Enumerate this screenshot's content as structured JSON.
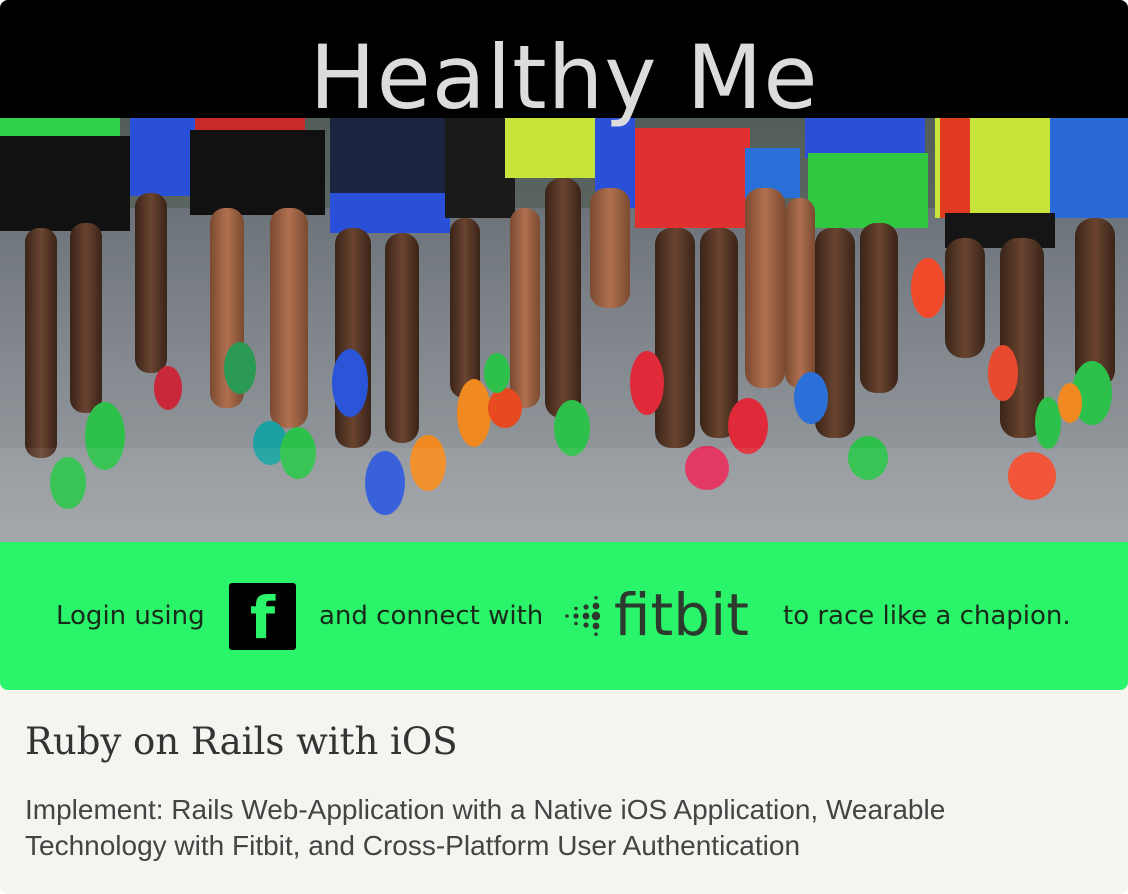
{
  "header": {
    "title": "Healthy Me"
  },
  "hero": {
    "image_description": "runners-racing-photo"
  },
  "cta": {
    "prefix": "Login using",
    "facebook_glyph": "f",
    "middle": "and connect with",
    "fitbit_wordmark": "fitbit",
    "suffix": "to race like a chapion.",
    "background_color": "#2af46a"
  },
  "project": {
    "title": "Ruby on Rails with iOS",
    "description": "Implement: Rails Web-Application with a Native iOS Application, Wearable Technology with Fitbit, and Cross-Platform User Authentication"
  },
  "icons": {
    "facebook": "facebook-icon",
    "fitbit": "fitbit-logo-icon"
  }
}
